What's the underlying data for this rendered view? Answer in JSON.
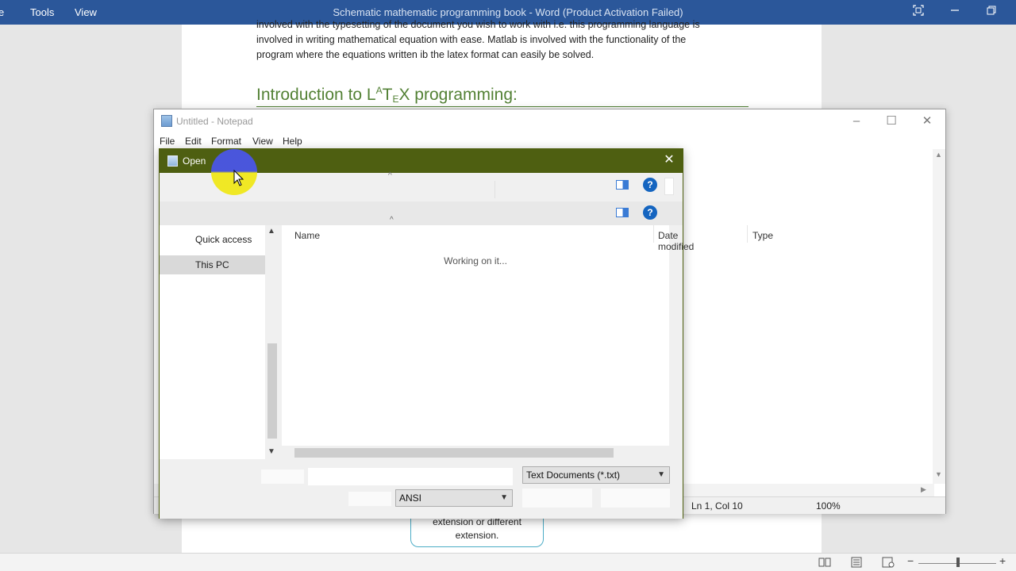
{
  "word": {
    "title": "Schematic mathematic programming book  -  Word (Product Activation Failed)",
    "menu": [
      "e",
      "Tools",
      "View"
    ],
    "doc_lines": [
      "involved with the typesetting of the document you wish to work with i.e. this programming language is",
      "involved in  writing mathematical equation with ease. Matlab is involved with the functionality of the",
      "program where the equations written ib the latex format can easily be solved."
    ],
    "heading_prefix": "Introduction to L",
    "heading_a": "A",
    "heading_t": "T",
    "heading_e": "E",
    "heading_suffix": "X programming:",
    "shape_text_1": "extension or different",
    "shape_text_2": "extension."
  },
  "notepad": {
    "title": "Untitled - Notepad",
    "menu": [
      "File",
      "Edit",
      "Format",
      "View",
      "Help"
    ],
    "status": {
      "position": "Ln 1, Col 10",
      "zoom": "100%"
    }
  },
  "open_dialog": {
    "title": "Open",
    "nav_items": [
      "Quick access",
      "This PC"
    ],
    "columns": [
      "Name",
      "Date modified",
      "Type"
    ],
    "status_text": "Working on it...",
    "file_type": "Text Documents (*.txt)",
    "encoding": "ANSI"
  },
  "colors": {
    "word_blue": "#2b579a",
    "dialog_title": "#4e5f11",
    "heading_green": "#538135"
  }
}
